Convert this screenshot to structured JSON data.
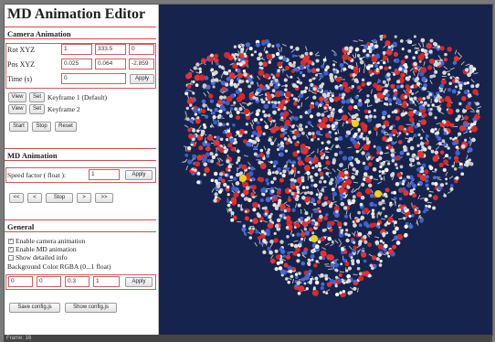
{
  "app": {
    "title": "MD Animation Editor"
  },
  "camera": {
    "section": "Camera Animation",
    "rot_label": "Rot XYZ",
    "rot": [
      "1",
      "333.5",
      "0"
    ],
    "pos_label": "Pos XYZ",
    "pos": [
      "0.025",
      "0.064",
      "-2.859"
    ],
    "time_label": "Time (s)",
    "time_value": "0",
    "apply_label": "Apply",
    "keyframes": [
      {
        "view": "View",
        "set": "Set",
        "label": "Keyframe 1 (Default)"
      },
      {
        "view": "View",
        "set": "Set",
        "label": "Keyframe 2"
      }
    ],
    "start_label": "Start",
    "stop_label": "Stop",
    "reset_label": "Reset"
  },
  "md": {
    "section": "MD Animation",
    "speed_label": "Speed factor ( float ):",
    "speed_value": "1",
    "apply_label": "Apply",
    "nav": [
      "<<",
      "<",
      "Stop",
      ">",
      ">>"
    ]
  },
  "general": {
    "section": "General",
    "checkboxes": [
      {
        "label": "Enable camera animation",
        "checked": true
      },
      {
        "label": "Enable MD animation",
        "checked": true
      },
      {
        "label": "Show detailed info",
        "checked": false
      }
    ],
    "bg_label": "Background Color RGBA (0...1 float)",
    "bg_values": [
      "0",
      "0",
      "0.3",
      "1"
    ],
    "apply_label": "Apply",
    "save_label": "Save config.js",
    "show_label": "Show config.js"
  },
  "status": {
    "text": "Frame: 16"
  },
  "viewport": {
    "background": "#16234c"
  }
}
